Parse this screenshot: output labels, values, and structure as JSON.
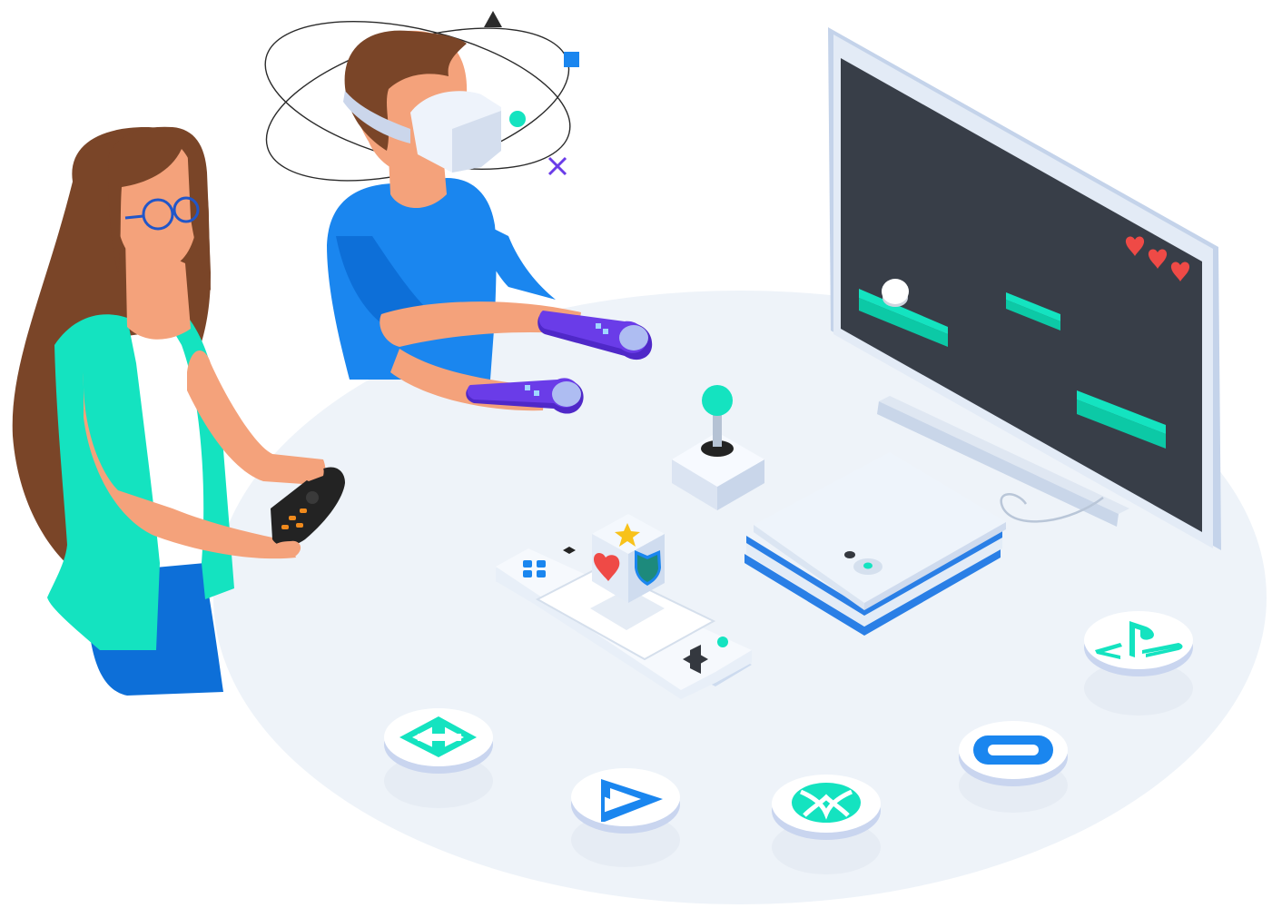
{
  "scene": {
    "palette": {
      "table": "#eef3f9",
      "table_shadow": "#e4ebf3",
      "teal": "#14e3c0",
      "teal_dark": "#0cc9a6",
      "blue": "#1a86ef",
      "blue_dark": "#0d6fd8",
      "purple": "#6a3ce8",
      "purple_dark": "#4f28c8",
      "skin": "#f4a27b",
      "hair": "#7a4528",
      "screen": "#383e48",
      "monitor": "#cad7ea",
      "console": "#f1f5fb",
      "heart": "#ef4a46",
      "star": "#f8c21a",
      "shield": "#1d8a7c",
      "dark": "#232323",
      "orange": "#f08a1c"
    },
    "platform_badges": [
      {
        "name": "unity-logo-icon"
      },
      {
        "name": "stadia-play-logo-icon"
      },
      {
        "name": "xbox-logo-icon"
      },
      {
        "name": "oculus-logo-icon"
      },
      {
        "name": "playstation-logo-icon"
      }
    ],
    "game_screen": {
      "lives": 3
    }
  }
}
